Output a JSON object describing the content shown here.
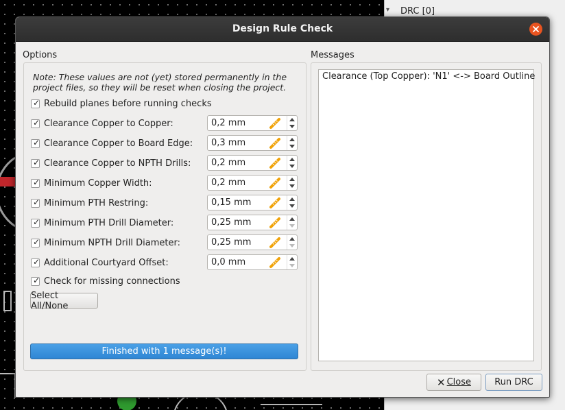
{
  "background": {
    "panel_title": "DRC [0]"
  },
  "dialog": {
    "title": "Design Rule Check",
    "options_label": "Options",
    "messages_label": "Messages",
    "note": "Note: These values are not (yet) stored permanently in the project files, so they will be reset when closing the project.",
    "rebuild_planes": {
      "label": "Rebuild planes before running checks",
      "checked": true
    },
    "rules": [
      {
        "label": "Clearance Copper to Copper:",
        "value": "0,2 mm",
        "checked": true,
        "down_enabled": true
      },
      {
        "label": "Clearance Copper to Board Edge:",
        "value": "0,3 mm",
        "checked": true,
        "down_enabled": true
      },
      {
        "label": "Clearance Copper to NPTH Drills:",
        "value": "0,2 mm",
        "checked": true,
        "down_enabled": true
      },
      {
        "label": "Minimum Copper Width:",
        "value": "0,2 mm",
        "checked": true,
        "down_enabled": true
      },
      {
        "label": "Minimum PTH Restring:",
        "value": "0,15 mm",
        "checked": true,
        "down_enabled": true
      },
      {
        "label": "Minimum PTH Drill Diameter:",
        "value": "0,25 mm",
        "checked": true,
        "down_enabled": false
      },
      {
        "label": "Minimum NPTH Drill Diameter:",
        "value": "0,25 mm",
        "checked": true,
        "down_enabled": false
      },
      {
        "label": "Additional Courtyard Offset:",
        "value": "0,0 mm",
        "checked": true,
        "down_enabled": false
      }
    ],
    "missing_connections": {
      "label": "Check for missing connections",
      "checked": true
    },
    "select_all_label": "Select All/None",
    "progress_text": "Finished with 1 message(s)!",
    "progress": 1.0,
    "messages": [
      "Clearance (Top Copper): 'N1' <-> Board Outline"
    ],
    "close_label": "Close",
    "run_label": "Run DRC",
    "colors": {
      "accent": "#2f86d4",
      "close_circle": "#e95420",
      "ruler": "#f0a30a"
    }
  }
}
